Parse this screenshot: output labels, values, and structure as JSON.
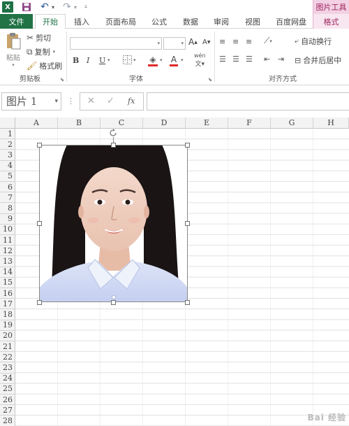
{
  "quick_access": {
    "app_icon": "excel-logo-icon",
    "app_letter": "X",
    "save_icon": "save-icon",
    "undo_icon": "undo-icon",
    "redo_icon": "redo-icon",
    "customize_icon": "customize-qat-icon"
  },
  "context_tab_group": "图片工具",
  "tabs": [
    {
      "label": "文件"
    },
    {
      "label": "开始"
    },
    {
      "label": "插入"
    },
    {
      "label": "页面布局"
    },
    {
      "label": "公式"
    },
    {
      "label": "数据"
    },
    {
      "label": "审阅"
    },
    {
      "label": "视图"
    },
    {
      "label": "百度网盘"
    },
    {
      "label": "格式"
    }
  ],
  "active_tab": "开始",
  "ribbon": {
    "clipboard": {
      "paste": "粘贴",
      "cut": "剪切",
      "copy": "复制",
      "format_painter": "格式刷",
      "group_label": "剪贴板"
    },
    "font": {
      "bold": "B",
      "italic": "I",
      "underline": "U",
      "grow": "A",
      "shrink": "A",
      "font_color": "A",
      "phonetic": "wén",
      "group_label": "字体"
    },
    "alignment": {
      "wrap_text": "自动换行",
      "merge_center": "合并后居中",
      "group_label": "对齐方式"
    }
  },
  "formula_bar": {
    "name_box": "图片 1",
    "cancel": "✕",
    "enter": "✓",
    "fx": "fx",
    "content": ""
  },
  "columns": [
    "A",
    "B",
    "C",
    "D",
    "E",
    "F",
    "G",
    "H"
  ],
  "rows": [
    "1",
    "2",
    "3",
    "4",
    "5",
    "6",
    "7",
    "8",
    "9",
    "10",
    "11",
    "12",
    "13",
    "14",
    "15",
    "16",
    "17",
    "18",
    "19",
    "20",
    "21",
    "22",
    "23",
    "24",
    "25",
    "26",
    "27",
    "28"
  ],
  "watermark": "Bai 经验",
  "colors": {
    "excel_green": "#217346",
    "context_tab": "#a0245e",
    "grid_line": "#e1e1e1"
  }
}
